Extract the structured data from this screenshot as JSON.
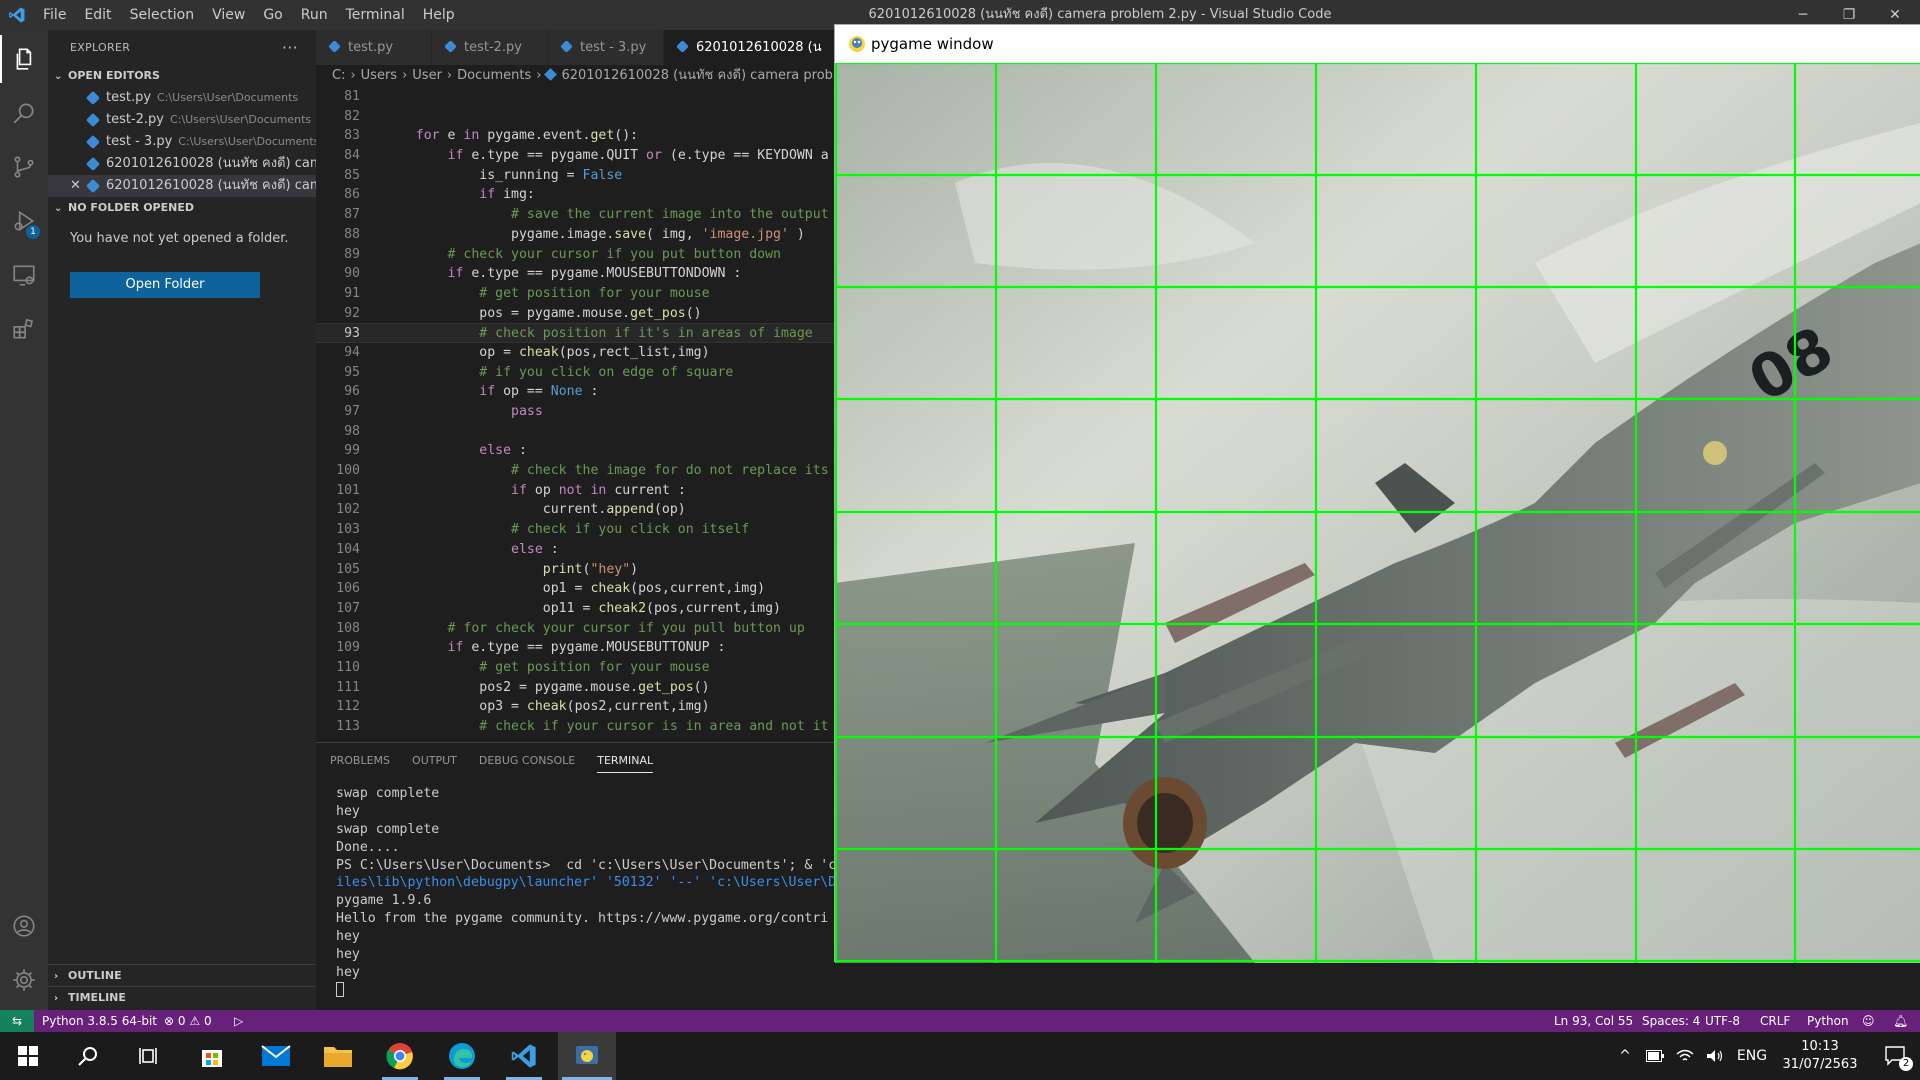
{
  "window": {
    "title": "6201012610028 (นนทัช คงดี) camera problem 2.py - Visual Studio Code",
    "minimize": "─",
    "maximize": "❐",
    "close": "✕"
  },
  "menu": [
    "File",
    "Edit",
    "Selection",
    "View",
    "Go",
    "Run",
    "Terminal",
    "Help"
  ],
  "activity_bar": {
    "debug_badge": "1"
  },
  "sidebar": {
    "title": "EXPLORER",
    "more": "···",
    "open_editors_label": "OPEN EDITORS",
    "open_editors": [
      {
        "name": "test.py",
        "path": "C:\\Users\\User\\Documents"
      },
      {
        "name": "test-2.py",
        "path": "C:\\Users\\User\\Documents"
      },
      {
        "name": "test - 3.py",
        "path": "C:\\Users\\User\\Documents"
      },
      {
        "name": "6201012610028 (นนทัช คงดี) cam...",
        "path": ""
      },
      {
        "name": "6201012610028 (นนทัช คงดี) cam...",
        "path": ""
      }
    ],
    "no_folder_label": "NO FOLDER OPENED",
    "no_folder_text": "You have not yet opened a folder.",
    "open_folder_button": "Open Folder",
    "outline_label": "OUTLINE",
    "timeline_label": "TIMELINE"
  },
  "tabs": [
    "test.py",
    "test-2.py",
    "test - 3.py",
    "6201012610028 (น"
  ],
  "breadcrumb": [
    "C:",
    "Users",
    "User",
    "Documents",
    "6201012610028 (นนทัช คงดี) camera problem"
  ],
  "code": [
    {
      "n": "81",
      "t": ""
    },
    {
      "n": "82",
      "t": ""
    },
    {
      "n": "83",
      "t": "    for e in pygame.event.get():"
    },
    {
      "n": "84",
      "t": "        if e.type == pygame.QUIT or (e.type == KEYDOWN a"
    },
    {
      "n": "85",
      "t": "            is_running = False"
    },
    {
      "n": "86",
      "t": "            if img:"
    },
    {
      "n": "87",
      "t": "                # save the current image into the output"
    },
    {
      "n": "88",
      "t": "                pygame.image.save( img, 'image.jpg' )"
    },
    {
      "n": "89",
      "t": "        # check your cursor if you put button down"
    },
    {
      "n": "90",
      "t": "        if e.type == pygame.MOUSEBUTTONDOWN :"
    },
    {
      "n": "91",
      "t": "            # get position for your mouse"
    },
    {
      "n": "92",
      "t": "            pos = pygame.mouse.get_pos()"
    },
    {
      "n": "93",
      "t": "            # check position if it's in areas of image"
    },
    {
      "n": "94",
      "t": "            op = cheak(pos,rect_list,img)"
    },
    {
      "n": "95",
      "t": "            # if you click on edge of square"
    },
    {
      "n": "96",
      "t": "            if op == None :"
    },
    {
      "n": "97",
      "t": "                pass"
    },
    {
      "n": "98",
      "t": ""
    },
    {
      "n": "99",
      "t": "            else :"
    },
    {
      "n": "100",
      "t": "                # check the image for do not replace its"
    },
    {
      "n": "101",
      "t": "                if op not in current :"
    },
    {
      "n": "102",
      "t": "                    current.append(op)"
    },
    {
      "n": "103",
      "t": "                # check if you click on itself"
    },
    {
      "n": "104",
      "t": "                else :"
    },
    {
      "n": "105",
      "t": "                    print(\"hey\")"
    },
    {
      "n": "106",
      "t": "                    op1 = cheak(pos,current,img)"
    },
    {
      "n": "107",
      "t": "                    op11 = cheak2(pos,current,img)"
    },
    {
      "n": "108",
      "t": "        # for check your cursor if you pull button up"
    },
    {
      "n": "109",
      "t": "        if e.type == pygame.MOUSEBUTTONUP :"
    },
    {
      "n": "110",
      "t": "            # get position for your mouse"
    },
    {
      "n": "111",
      "t": "            pos2 = pygame.mouse.get_pos()"
    },
    {
      "n": "112",
      "t": "            op3 = cheak(pos2,current,img)"
    },
    {
      "n": "113",
      "t": "            # check if your cursor is in area and not it"
    }
  ],
  "panel": {
    "tabs": [
      "PROBLEMS",
      "OUTPUT",
      "DEBUG CONSOLE",
      "TERMINAL"
    ],
    "active_tab": "TERMINAL",
    "terminal": [
      "swap complete",
      "hey",
      "swap complete",
      "Done....",
      "PS C:\\Users\\User\\Documents>  cd 'c:\\Users\\User\\Documents'; & 'c",
      "iles\\lib\\python\\debugpy\\launcher' '50132' '--' 'c:\\Users\\User\\D",
      "pygame 1.9.6",
      "Hello from the pygame community. https://www.pygame.org/contri",
      "hey",
      "hey",
      "hey"
    ]
  },
  "pygame_window": {
    "title": "pygame window",
    "grid_color": "#00ff00",
    "aircraft_number": "08"
  },
  "status": {
    "interpreter": "Python 3.8.5 64-bit",
    "errors": "0",
    "warnings": "0",
    "position": "Ln 93, Col 55",
    "spaces": "Spaces: 4",
    "encoding": "UTF-8",
    "eol": "CRLF",
    "language": "Python",
    "color": "#68217a"
  },
  "taskbar": {
    "language": "ENG",
    "time": "10:13",
    "date": "31/07/2563",
    "notification_count": "2"
  }
}
